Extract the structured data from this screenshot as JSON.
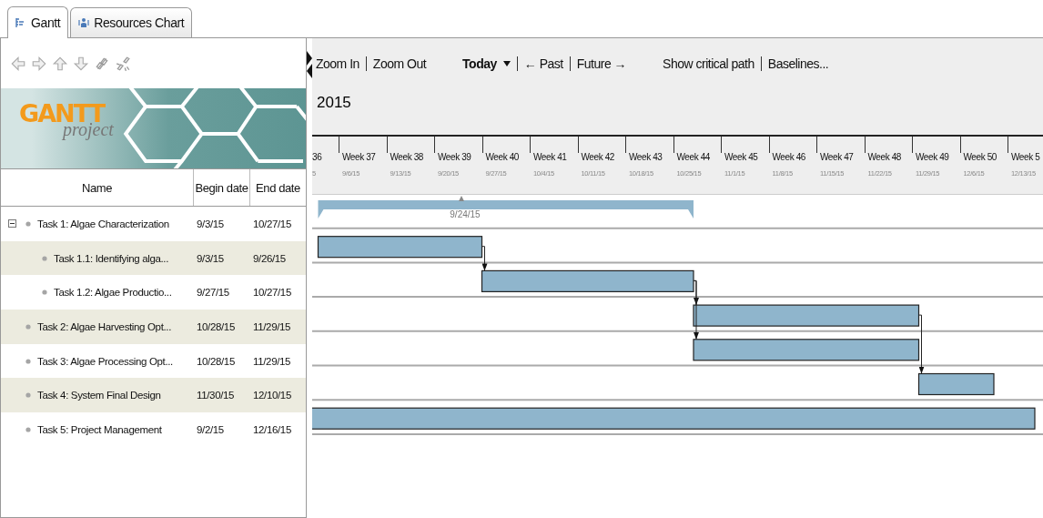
{
  "tabs": [
    {
      "label": "Gantt",
      "selected": true,
      "kind": "gantt"
    },
    {
      "label": "Resources Chart",
      "selected": false,
      "kind": "resources"
    }
  ],
  "logo": {
    "title": "GANTT",
    "subtitle": "project"
  },
  "columns": [
    "Name",
    "Begin date",
    "End date"
  ],
  "toolbar": {
    "zoom": [
      "Zoom In",
      "Zoom Out"
    ],
    "today": "Today",
    "nav": [
      "← Past",
      "Future →"
    ],
    "extra": [
      "Show critical path",
      "Baselines..."
    ]
  },
  "year": "2015",
  "weeks": [
    {
      "label": "36",
      "date": "5"
    },
    {
      "label": "Week 37",
      "date": "9/6/15"
    },
    {
      "label": "Week 38",
      "date": "9/13/15"
    },
    {
      "label": "Week 39",
      "date": "9/20/15"
    },
    {
      "label": "Week 40",
      "date": "9/27/15"
    },
    {
      "label": "Week 41",
      "date": "10/4/15"
    },
    {
      "label": "Week 42",
      "date": "10/11/15"
    },
    {
      "label": "Week 43",
      "date": "10/18/15"
    },
    {
      "label": "Week 44",
      "date": "10/25/15"
    },
    {
      "label": "Week 45",
      "date": "11/1/15"
    },
    {
      "label": "Week 46",
      "date": "11/8/15"
    },
    {
      "label": "Week 47",
      "date": "11/15/15"
    },
    {
      "label": "Week 48",
      "date": "11/22/15"
    },
    {
      "label": "Week 49",
      "date": "11/29/15"
    },
    {
      "label": "Week 50",
      "date": "12/6/15"
    },
    {
      "label": "Week 5",
      "date": "12/13/15"
    }
  ],
  "tasks": [
    {
      "name": "Task 1: Algae Characterization",
      "begin": "9/3/15",
      "end": "10/27/15",
      "expanded": true,
      "summary_label": "9/24/15",
      "children": [
        {
          "name": "Task 1.1: Identifying alga...",
          "begin": "9/3/15",
          "end": "9/26/15"
        },
        {
          "name": "Task 1.2: Algae Productio...",
          "begin": "9/27/15",
          "end": "10/27/15"
        }
      ]
    },
    {
      "name": "Task 2: Algae Harvesting Opt...",
      "begin": "10/28/15",
      "end": "11/29/15"
    },
    {
      "name": "Task 3: Algae Processing Opt...",
      "begin": "10/28/15",
      "end": "11/29/15"
    },
    {
      "name": "Task 4: System Final Design",
      "begin": "11/30/15",
      "end": "12/10/15"
    },
    {
      "name": "Task 5: Project Management",
      "begin": "9/2/15",
      "end": "12/16/15"
    }
  ]
}
